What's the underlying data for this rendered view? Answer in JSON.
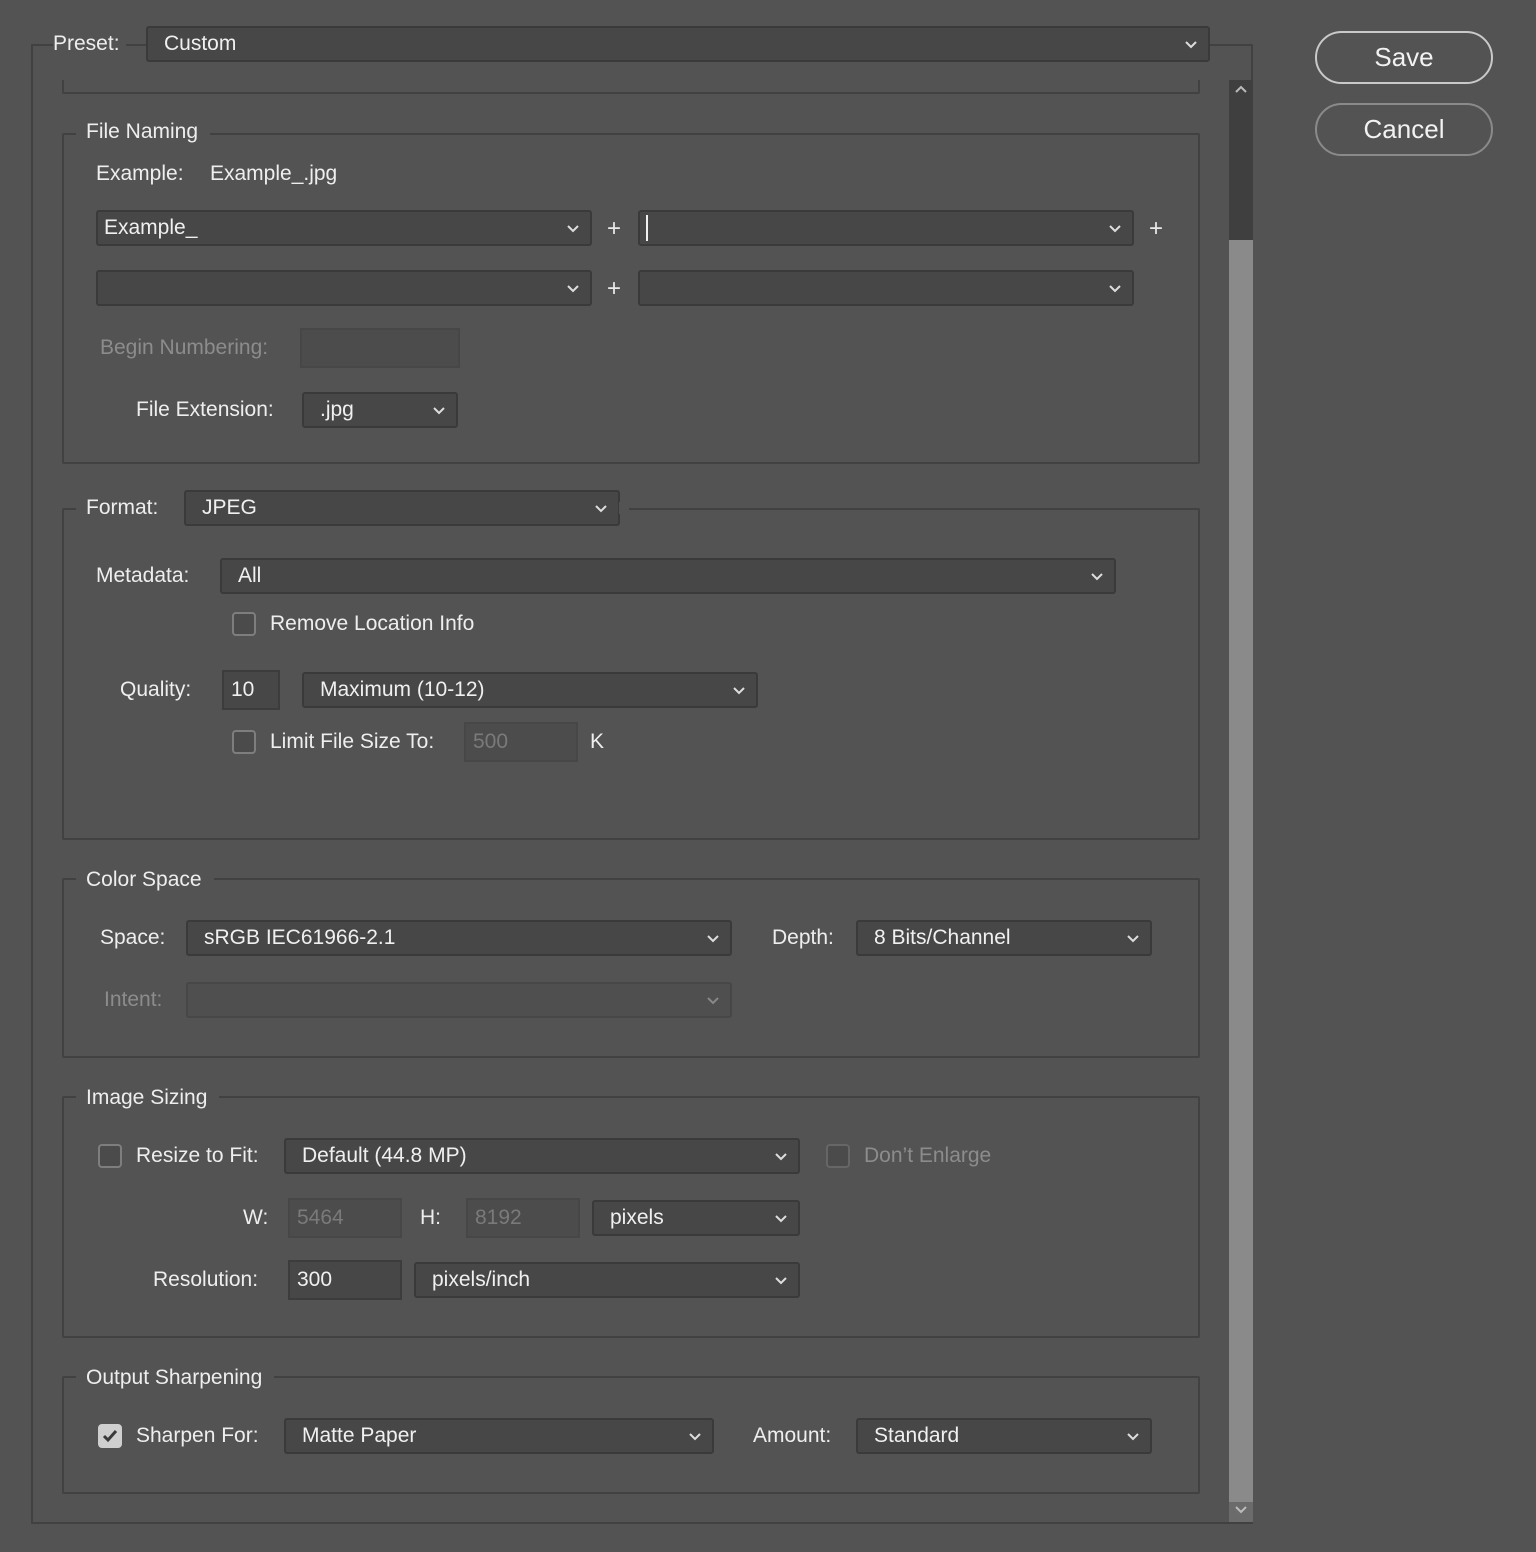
{
  "preset": {
    "label": "Preset:",
    "value": "Custom"
  },
  "buttons": {
    "save": "Save",
    "cancel": "Cancel"
  },
  "file_naming": {
    "title": "File Naming",
    "example_label": "Example:",
    "example_value": "Example_.jpg",
    "name_part_1": "Example_",
    "name_part_2": "",
    "name_part_3": "",
    "name_part_4": "",
    "plus": "+",
    "begin_numbering_label": "Begin Numbering:",
    "begin_numbering_value": "",
    "file_extension_label": "File Extension:",
    "file_extension_value": ".jpg"
  },
  "format": {
    "label": "Format:",
    "value": "JPEG",
    "metadata_label": "Metadata:",
    "metadata_value": "All",
    "remove_location_label": "Remove Location Info",
    "remove_location_checked": false,
    "quality_label": "Quality:",
    "quality_value": "10",
    "quality_preset": "Maximum  (10-12)",
    "limit_size_label": "Limit File Size To:",
    "limit_size_value": "500",
    "limit_size_unit": "K",
    "limit_size_checked": false
  },
  "color_space": {
    "title": "Color Space",
    "space_label": "Space:",
    "space_value": "sRGB IEC61966-2.1",
    "depth_label": "Depth:",
    "depth_value": "8 Bits/Channel",
    "intent_label": "Intent:",
    "intent_value": ""
  },
  "image_sizing": {
    "title": "Image Sizing",
    "resize_label": "Resize to Fit:",
    "resize_checked": false,
    "resize_value": "Default  (44.8 MP)",
    "dont_enlarge_label": "Don’t Enlarge",
    "w_label": "W:",
    "w_value": "5464",
    "h_label": "H:",
    "h_value": "8192",
    "unit_value": "pixels",
    "resolution_label": "Resolution:",
    "resolution_value": "300",
    "resolution_unit": "pixels/inch"
  },
  "output_sharpening": {
    "title": "Output Sharpening",
    "sharpen_label": "Sharpen For:",
    "sharpen_checked": true,
    "sharpen_value": "Matte Paper",
    "amount_label": "Amount:",
    "amount_value": "Standard"
  },
  "colors": {
    "background": "#535353",
    "field": "#474747",
    "border": "#414141"
  }
}
